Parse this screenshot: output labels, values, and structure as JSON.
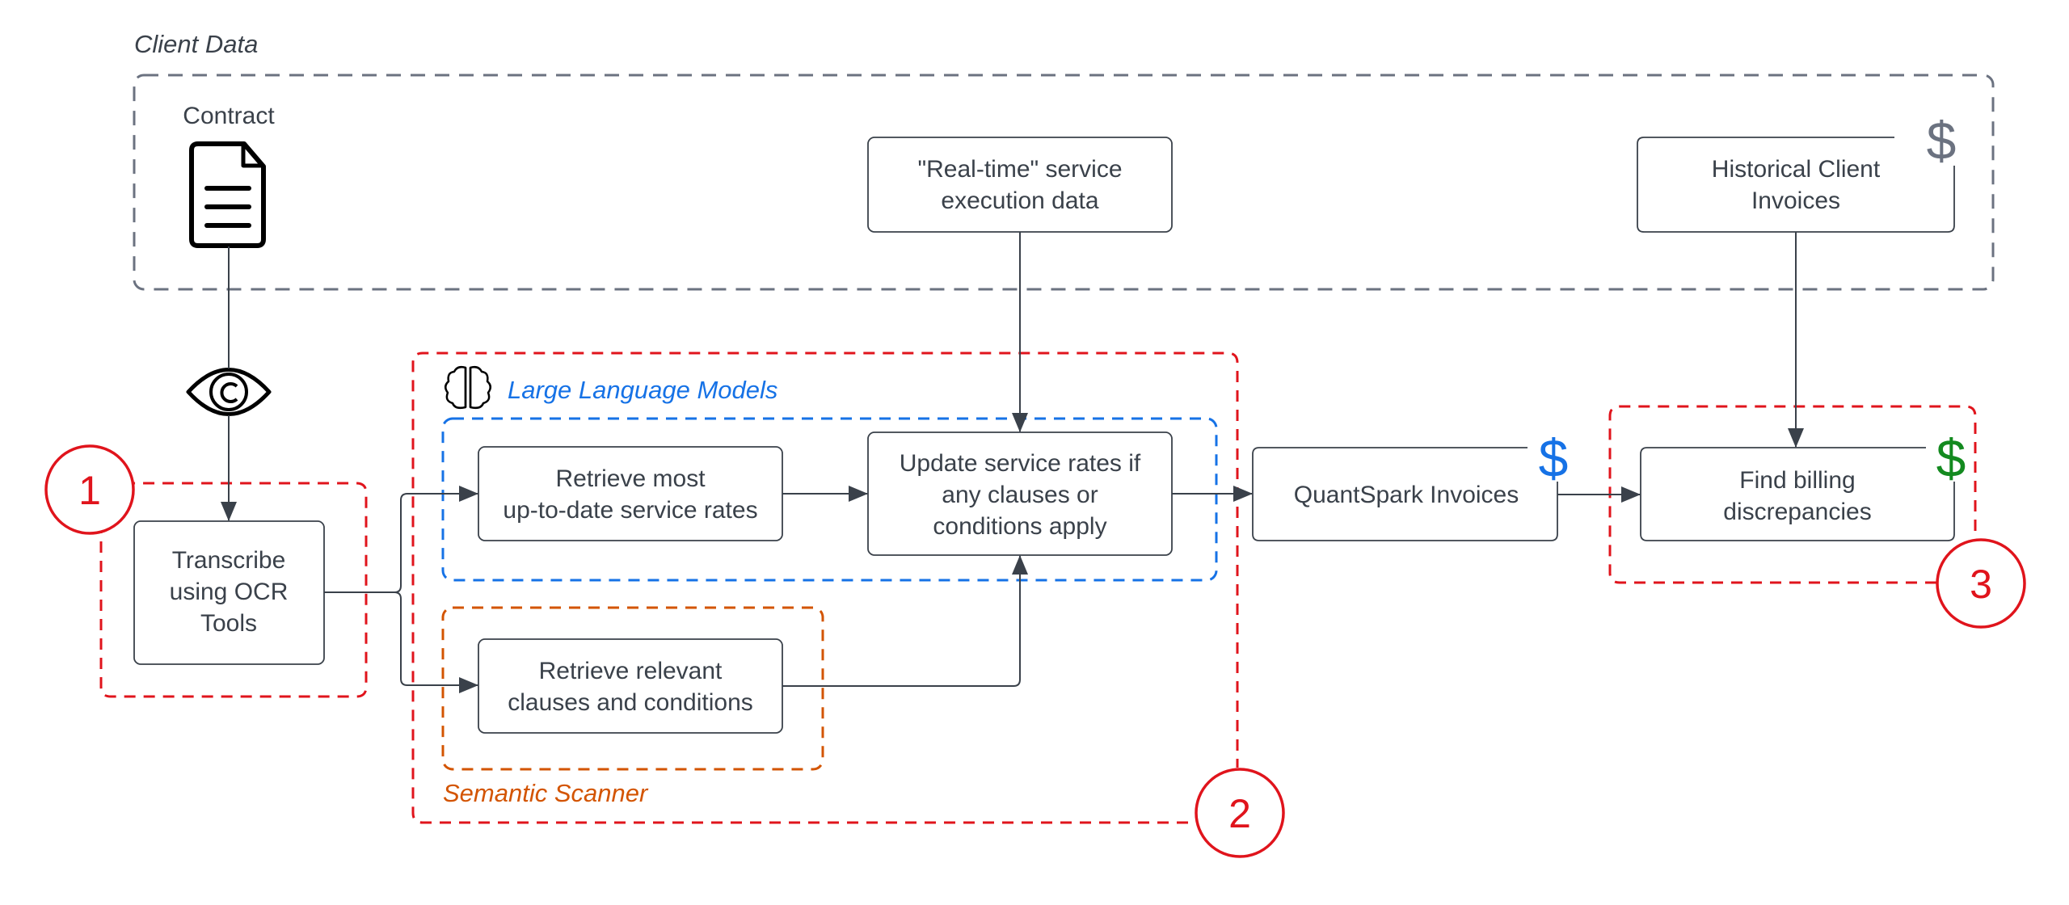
{
  "title": "Client billing discrepancy pipeline",
  "colors": {
    "ink": "#3a414a",
    "client_border": "#6b7280",
    "section_red": "#e0141c",
    "llm_blue": "#1672e6",
    "semantic_orange": "#d35400",
    "dollar_gray": "#6b7280",
    "dollar_blue": "#1672e6",
    "dollar_green": "#138a1f"
  },
  "client_data": {
    "label": "Client Data",
    "contract_label": "Contract",
    "contract_icon": "document-icon",
    "realtime": [
      "\"Real-time\" service",
      "execution data"
    ],
    "historical": [
      "Historical Client",
      "Invoices"
    ],
    "historical_badge": "$"
  },
  "ocr_eye_icon": "eye-icon",
  "sections": {
    "s1": {
      "number": "1",
      "box": [
        "Transcribe",
        "using OCR",
        "Tools"
      ]
    },
    "s2": {
      "number": "2",
      "llm_label": "Large Language Models",
      "llm_icon": "brain-icon",
      "retrieve_rates": [
        "Retrieve most",
        "up-to-date service rates"
      ],
      "update_rates": [
        "Update service rates if",
        "any clauses or",
        "conditions apply"
      ],
      "semantic_label": "Semantic Scanner",
      "retrieve_clauses": [
        "Retrieve relevant",
        "clauses and conditions"
      ]
    },
    "quantspark": {
      "label": "QuantSpark Invoices",
      "badge": "$"
    },
    "s3": {
      "number": "3",
      "box": [
        "Find billing",
        "discrepancies"
      ],
      "badge": "$"
    }
  }
}
